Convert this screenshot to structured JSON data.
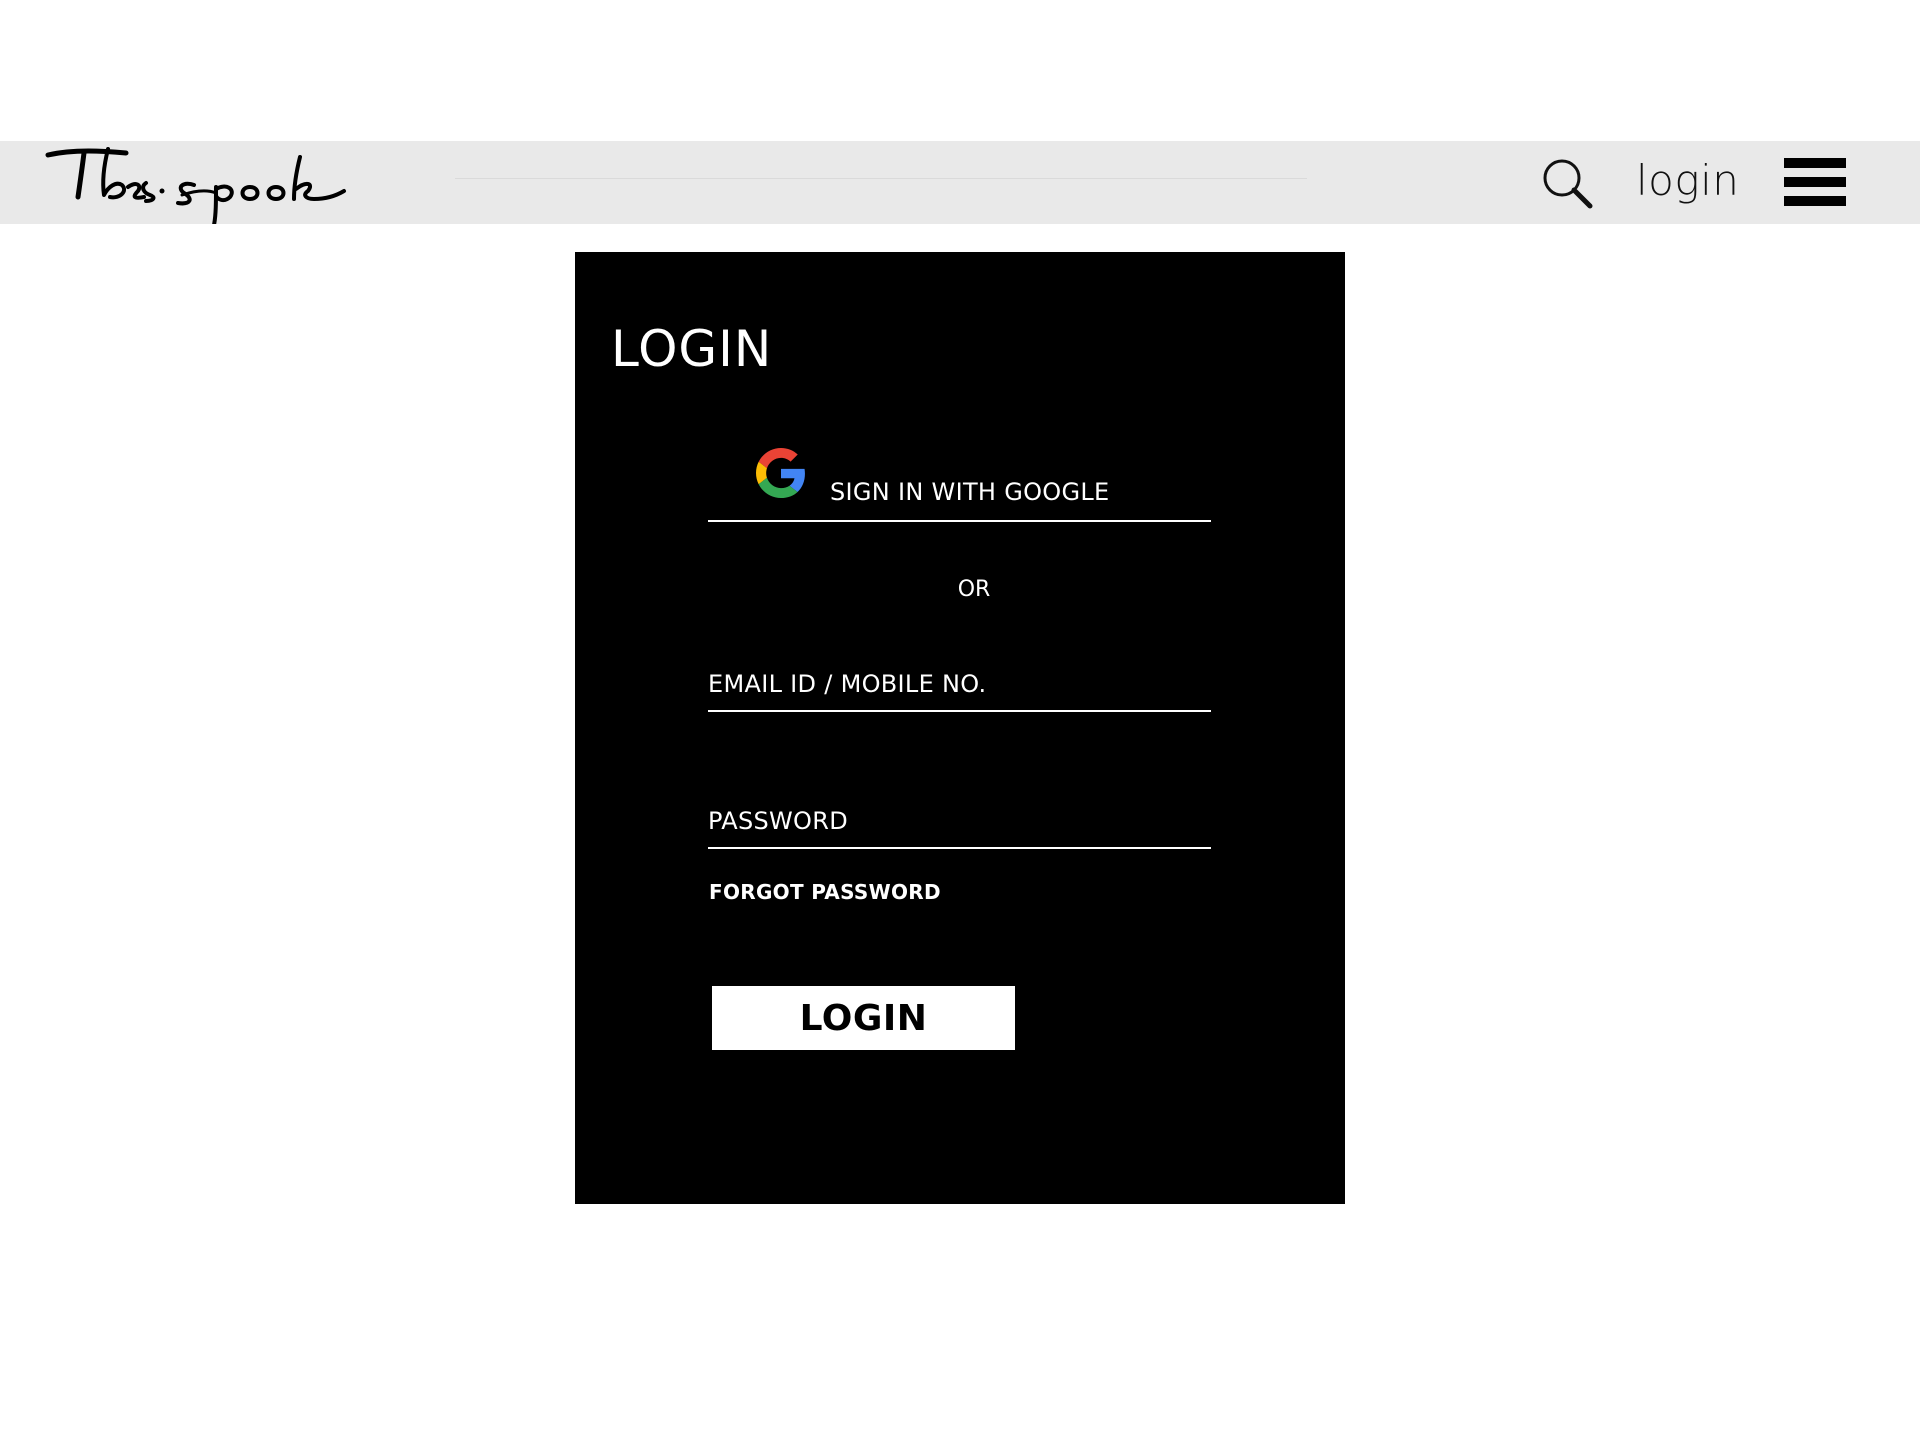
{
  "header": {
    "logo_text": "The spook",
    "login_link": "login",
    "icons": {
      "search": "search-icon",
      "menu": "hamburger-menu-icon"
    }
  },
  "login_panel": {
    "title": "LOGIN",
    "google_button_label": "SIGN IN WITH GOOGLE",
    "google_icon": "google-logo-icon",
    "or_separator": "OR",
    "email_placeholder": "EMAIL ID / MOBILE NO.",
    "email_value": "",
    "password_placeholder": "PASSWORD",
    "password_value": "",
    "forgot_password": "FORGOT PASSWORD",
    "submit_label": "LOGIN"
  },
  "colors": {
    "header_bg": "#e9e9e9",
    "panel_bg": "#000000",
    "panel_text": "#ffffff",
    "button_bg": "#ffffff",
    "button_text": "#000000",
    "google_blue": "#4285F4",
    "google_red": "#EA4335",
    "google_yellow": "#FBBC05",
    "google_green": "#34A853"
  }
}
